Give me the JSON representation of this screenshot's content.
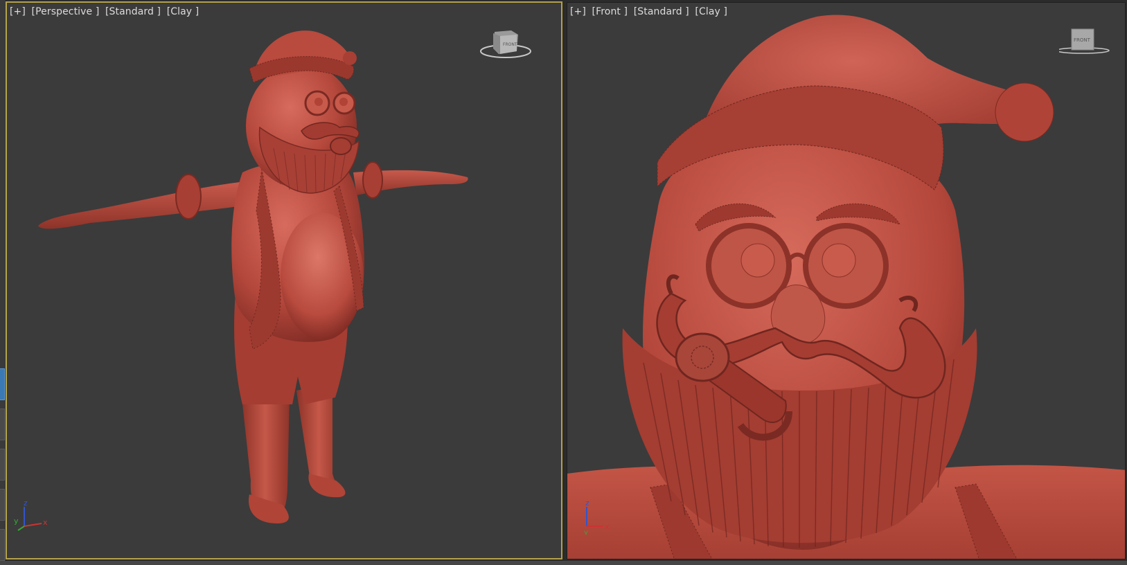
{
  "viewports": {
    "left": {
      "labels": [
        "[+]",
        "[Perspective ]",
        "[Standard ]",
        "[Clay ]"
      ],
      "active": true,
      "viewcube_face": "FRONT",
      "viewcube_side": "LEFT"
    },
    "right": {
      "labels": [
        "[+]",
        "[Front ]",
        "[Standard ]",
        "[Clay ]"
      ],
      "active": false,
      "viewcube_face": "FRONT"
    }
  },
  "axes": {
    "z": "z",
    "y": "y",
    "x": "x"
  },
  "colors": {
    "clay": "#b84a3e",
    "clay_dark": "#8a2f27",
    "clay_light": "#d46a5c",
    "active_border": "#b4a24b",
    "viewport_bg": "#3b3b3b",
    "axis_x": "#cc3333",
    "axis_y": "#33aa33",
    "axis_z": "#3355cc"
  }
}
